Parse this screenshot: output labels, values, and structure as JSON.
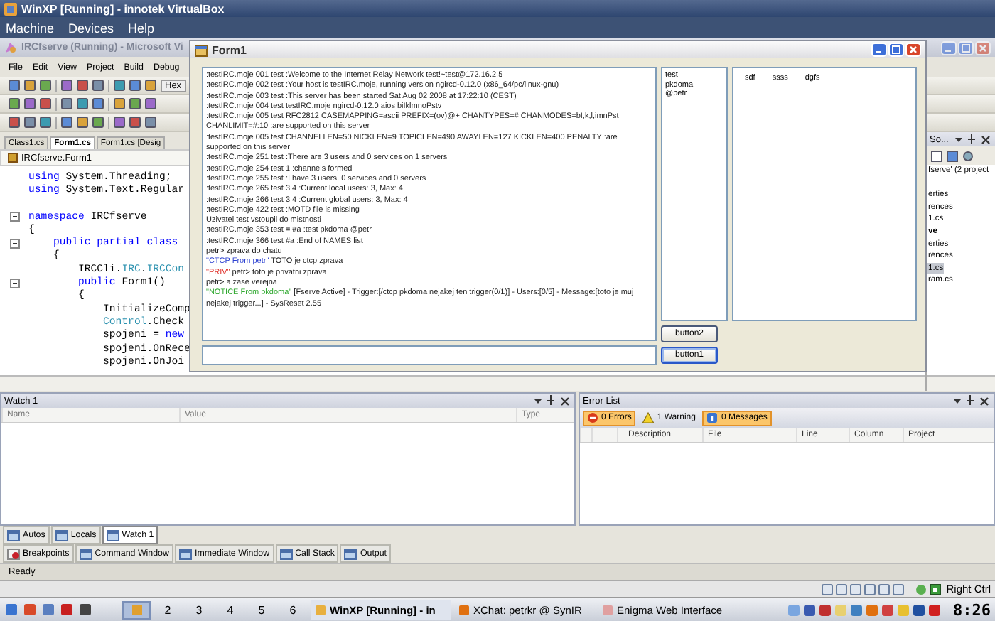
{
  "virtualbox": {
    "title": "WinXP [Running] - innotek VirtualBox",
    "menu": [
      "Machine",
      "Devices",
      "Help"
    ],
    "host_key": "Right Ctrl"
  },
  "visual_studio": {
    "title": "IRCfserve (Running) - Microsoft Vi",
    "menu": [
      "File",
      "Edit",
      "View",
      "Project",
      "Build",
      "Debug"
    ],
    "toolbar_button": "Hex",
    "doc_tabs": [
      {
        "label": "Class1.cs",
        "selected": false
      },
      {
        "label": "Form1.cs",
        "selected": true
      },
      {
        "label": "Form1.cs [Desig",
        "selected": false
      }
    ],
    "breadcrumb": "IRCfserve.Form1",
    "code": [
      {
        "fold": false,
        "gap_before": false,
        "segments": [
          {
            "kind": "keyword",
            "text": "using"
          },
          {
            "kind": "plain",
            "text": " System.Threading;"
          }
        ]
      },
      {
        "fold": false,
        "gap_before": false,
        "segments": [
          {
            "kind": "keyword",
            "text": "using"
          },
          {
            "kind": "plain",
            "text": " System.Text.Regular"
          }
        ]
      },
      {
        "fold": true,
        "gap_before": true,
        "segments": [
          {
            "kind": "keyword",
            "text": "namespace"
          },
          {
            "kind": "plain",
            "text": " IRCfserve"
          }
        ]
      },
      {
        "fold": false,
        "gap_before": false,
        "segments": [
          {
            "kind": "plain",
            "text": "{"
          }
        ]
      },
      {
        "fold": true,
        "gap_before": false,
        "segments": [
          {
            "kind": "keyword",
            "text": "    public partial class"
          }
        ]
      },
      {
        "fold": false,
        "gap_before": false,
        "segments": [
          {
            "kind": "plain",
            "text": "    {"
          }
        ]
      },
      {
        "fold": false,
        "gap_before": false,
        "segments": [
          {
            "kind": "plain",
            "text": "        IRCCli."
          },
          {
            "kind": "type",
            "text": "IRC"
          },
          {
            "kind": "plain",
            "text": "."
          },
          {
            "kind": "type",
            "text": "IRCCon"
          }
        ]
      },
      {
        "fold": true,
        "gap_before": false,
        "segments": [
          {
            "kind": "keyword",
            "text": "        public"
          },
          {
            "kind": "plain",
            "text": " Form1()"
          }
        ]
      },
      {
        "fold": false,
        "gap_before": false,
        "segments": [
          {
            "kind": "plain",
            "text": "        {"
          }
        ]
      },
      {
        "fold": false,
        "gap_before": false,
        "segments": [
          {
            "kind": "plain",
            "text": "            InitializeComp"
          }
        ]
      },
      {
        "fold": false,
        "gap_before": false,
        "segments": [
          {
            "kind": "type",
            "text": "            Control"
          },
          {
            "kind": "plain",
            "text": ".Check"
          }
        ]
      },
      {
        "fold": false,
        "gap_before": false,
        "segments": [
          {
            "kind": "plain",
            "text": "            spojeni = "
          },
          {
            "kind": "keyword",
            "text": "new"
          }
        ]
      },
      {
        "fold": false,
        "gap_before": false,
        "segments": [
          {
            "kind": "plain",
            "text": "            spojeni.OnRece"
          }
        ]
      },
      {
        "fold": false,
        "gap_before": false,
        "segments": [
          {
            "kind": "plain",
            "text": "            spojeni.OnJoi"
          }
        ]
      }
    ],
    "solution_explorer": {
      "title": "So...",
      "items": [
        {
          "label": "fserve' (2 project",
          "bold": false,
          "selected": false,
          "gap_before": false
        },
        {
          "label": "erties",
          "bold": false,
          "selected": false,
          "gap_before": true
        },
        {
          "label": "rences",
          "bold": false,
          "selected": false,
          "gap_before": false
        },
        {
          "label": "1.cs",
          "bold": false,
          "selected": false,
          "gap_before": false
        },
        {
          "label": "ve",
          "bold": true,
          "selected": false,
          "gap_before": false
        },
        {
          "label": "erties",
          "bold": false,
          "selected": false,
          "gap_before": false
        },
        {
          "label": "rences",
          "bold": false,
          "selected": false,
          "gap_before": false
        },
        {
          "label": "1.cs",
          "bold": false,
          "selected": true,
          "gap_before": false
        },
        {
          "label": "ram.cs",
          "bold": false,
          "selected": false,
          "gap_before": false
        }
      ]
    },
    "watch": {
      "title": "Watch 1",
      "columns": [
        "Name",
        "Value",
        "Type"
      ]
    },
    "error_list": {
      "title": "Error List",
      "filters": [
        {
          "kind": "error",
          "label": "0 Errors",
          "selected": true
        },
        {
          "kind": "warning",
          "label": "1 Warning",
          "selected": false
        },
        {
          "kind": "message",
          "label": "0 Messages",
          "selected": true
        }
      ],
      "columns": [
        "Description",
        "File",
        "Line",
        "Column",
        "Project"
      ]
    },
    "tool_tabs": [
      {
        "label": "Autos",
        "selected": false
      },
      {
        "label": "Locals",
        "selected": false
      },
      {
        "label": "Watch 1",
        "selected": true
      }
    ],
    "window_tabs": [
      "Breakpoints",
      "Command Window",
      "Immediate Window",
      "Call Stack",
      "Output"
    ],
    "status": "Ready"
  },
  "form1": {
    "title": "Form1",
    "chat": [
      {
        "text": ":testIRC.moje 001 test :Welcome to the Internet Relay Network test!~test@172.16.2.5"
      },
      {
        "text": ":testIRC.moje 002 test :Your host is testIRC.moje, running version ngircd-0.12.0 (x86_64/pc/linux-gnu)"
      },
      {
        "text": ":testIRC.moje 003 test :This server has been started Sat Aug 02 2008 at 17:22:10 (CEST)"
      },
      {
        "text": ":testIRC.moje 004 test testIRC.moje ngircd-0.12.0 aios biIklmnoPstv"
      },
      {
        "text": ":testIRC.moje 005 test RFC2812 CASEMAPPING=ascii PREFIX=(ov)@+ CHANTYPES=# CHANMODES=bI,k,l,imnPst CHANLIMIT=#:10 :are supported on this server"
      },
      {
        "text": ":testIRC.moje 005 test CHANNELLEN=50 NICKLEN=9 TOPICLEN=490 AWAYLEN=127 KICKLEN=400 PENALTY :are supported on this server"
      },
      {
        "text": ":testIRC.moje 251 test :There are 3 users and 0 services on 1 servers"
      },
      {
        "text": ":testIRC.moje 254 test 1 :channels formed"
      },
      {
        "text": ":testIRC.moje 255 test :I have 3 users, 0 services and 0 servers"
      },
      {
        "text": ":testIRC.moje 265 test 3 4 :Current local users: 3, Max: 4"
      },
      {
        "text": ":testIRC.moje 266 test 3 4 :Current global users: 3, Max: 4"
      },
      {
        "text": ":testIRC.moje 422 test :MOTD file is missing"
      },
      {
        "text": "Uzivatel test vstoupil do mistnosti"
      },
      {
        "text": ":testIRC.moje 353 test = #a :test pkdoma @petr"
      },
      {
        "text": ":testIRC.moje 366 test #a :End of NAMES list"
      },
      {
        "text": "petr> zprava do chatu"
      },
      {
        "tag": "\"CTCP From petr\"",
        "color": "#2a3fd0",
        "text": " TOTO je ctcp zprava"
      },
      {
        "tag": "\"PRIV\"",
        "color": "#e0302a",
        "text": " petr> toto je privatni zprava"
      },
      {
        "text": "petr> a zase verejna"
      },
      {
        "tag": "\"NOTICE From pkdoma\"",
        "color": "#2fa82f",
        "text": " [Fserve Active] - Trigger:[/ctcp pkdoma nejakej ten trigger(0/1)] - Users:[0/5] - Message:[toto je muj nejakej trigger...] - SysReset 2.55"
      }
    ],
    "users": [
      "test",
      "pkdoma",
      "@petr"
    ],
    "list_columns": [
      "sdf",
      "ssss",
      "dgfs"
    ],
    "buttons": [
      {
        "label": "button2",
        "focused": false
      },
      {
        "label": "button1",
        "focused": true
      }
    ]
  },
  "taskbar": {
    "workspaces": [
      {
        "kind": "icon",
        "selected": true
      },
      {
        "kind": "number",
        "label": "2",
        "selected": false
      },
      {
        "kind": "number",
        "label": "3",
        "selected": false
      },
      {
        "kind": "number",
        "label": "4",
        "selected": false
      },
      {
        "kind": "number",
        "label": "5",
        "selected": false
      },
      {
        "kind": "number",
        "label": "6",
        "selected": false
      }
    ],
    "tasks": [
      {
        "label": "WinXP [Running] - in",
        "selected": true
      },
      {
        "label": "XChat: petrkr @ SynIR",
        "selected": false
      },
      {
        "label": "Enigma Web Interface",
        "selected": false
      }
    ],
    "clock": "8:26"
  }
}
